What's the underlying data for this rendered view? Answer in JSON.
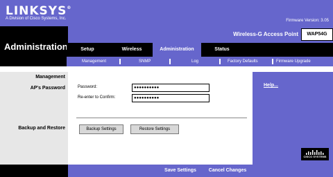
{
  "header": {
    "logo": "LINKSYS",
    "logo_tm": "®",
    "subtitle": "A Division of Cisco Systems, Inc.",
    "firmware": "Firmware Version: 3.05"
  },
  "section_title": "Administration",
  "product": {
    "name": "Wireless-G Access Point",
    "model": "WAP54G"
  },
  "tabs": [
    {
      "label": "Setup"
    },
    {
      "label": "Wireless"
    },
    {
      "label": "Administration"
    },
    {
      "label": "Status"
    }
  ],
  "subtabs": [
    {
      "label": "Management"
    },
    {
      "label": "SNMP"
    },
    {
      "label": "Log"
    },
    {
      "label": "Factory Defaults"
    },
    {
      "label": "Firmware Upgrade"
    }
  ],
  "left_labels": {
    "title": "Management",
    "aps_password": "AP's Password",
    "backup_restore": "Backup and Restore"
  },
  "form": {
    "password_label": "Password:",
    "password_value": "●●●●●●●●●●",
    "confirm_label": "Re-enter to Confirm:",
    "confirm_value": "●●●●●●●●●●",
    "backup_button": "Backup Settings",
    "restore_button": "Restore Settings"
  },
  "help": {
    "link": "Help..."
  },
  "cisco": {
    "text": "CISCO SYSTEMS"
  },
  "footer": {
    "save": "Save Settings",
    "cancel": "Cancel Changes"
  },
  "colors": {
    "accent": "#6666cc",
    "black": "#000000",
    "label_bg": "#e7e7e7"
  }
}
